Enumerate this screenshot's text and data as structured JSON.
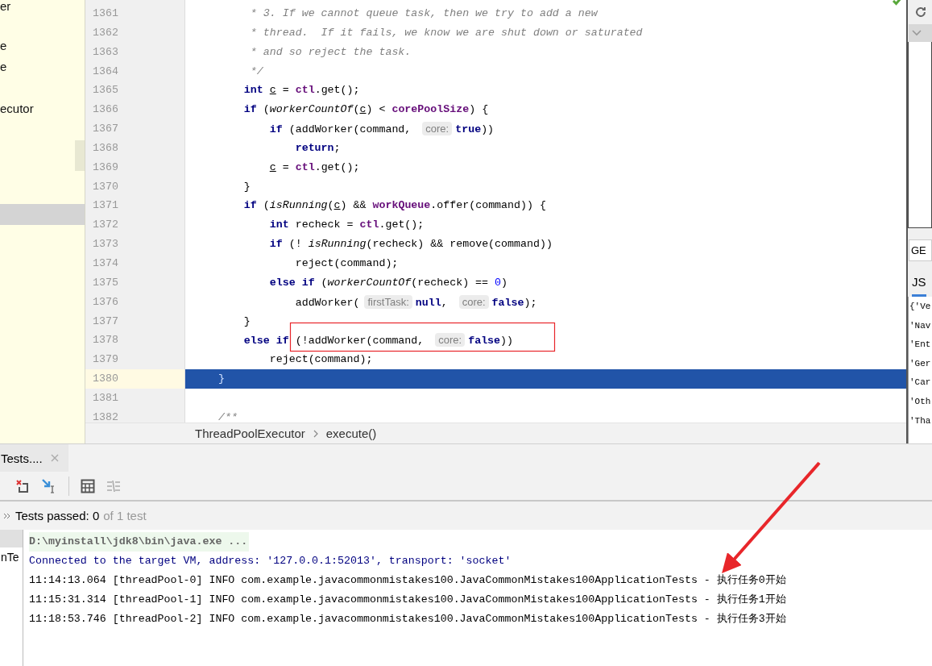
{
  "project_panel": {
    "items": [
      {
        "label": "er",
        "selected": false
      },
      {
        "label": "e",
        "selected": false
      },
      {
        "label": "e",
        "selected": false
      },
      {
        "label": "ecutor",
        "selected": false
      },
      {
        "selected": true
      }
    ]
  },
  "code": {
    "lines": [
      {
        "number": "1361",
        "selected": false,
        "tokens": [
          {
            "kind": "comment",
            "text": "         * 3. If we cannot queue task, then we try to add a new"
          }
        ]
      },
      {
        "number": "1362",
        "selected": false,
        "tokens": [
          {
            "kind": "comment",
            "text": "         * thread.  If it fails, we know we are shut down or saturated"
          }
        ]
      },
      {
        "number": "1363",
        "selected": false,
        "tokens": [
          {
            "kind": "comment",
            "text": "         * and so reject the task."
          }
        ]
      },
      {
        "number": "1364",
        "selected": false,
        "tokens": [
          {
            "kind": "comment",
            "text": "         */"
          }
        ]
      },
      {
        "number": "1365",
        "selected": false,
        "tokens": [
          {
            "kind": "kw",
            "text": "        int "
          },
          {
            "kind": "var",
            "text": "c"
          },
          {
            "kind": "plain",
            "text": " = "
          },
          {
            "kind": "field",
            "text": "ctl"
          },
          {
            "kind": "plain",
            "text": ".get();"
          }
        ]
      },
      {
        "number": "1366",
        "selected": false,
        "tokens": [
          {
            "kind": "kw",
            "text": "        if"
          },
          {
            "kind": "plain",
            "text": " ("
          },
          {
            "kind": "fn",
            "text": "workerCountOf"
          },
          {
            "kind": "plain",
            "text": "("
          },
          {
            "kind": "var",
            "text": "c"
          },
          {
            "kind": "plain",
            "text": ") < "
          },
          {
            "kind": "field",
            "text": "corePoolSize"
          },
          {
            "kind": "plain",
            "text": ") {"
          }
        ]
      },
      {
        "number": "1367",
        "selected": false,
        "tokens": [
          {
            "kind": "kw",
            "text": "            if"
          },
          {
            "kind": "plain",
            "text": " (addWorker(command, "
          },
          {
            "kind": "hint",
            "text": "core:"
          },
          {
            "kind": "kw",
            "text": "true"
          },
          {
            "kind": "plain",
            "text": "))"
          }
        ]
      },
      {
        "number": "1368",
        "selected": false,
        "tokens": [
          {
            "kind": "kw",
            "text": "                return"
          },
          {
            "kind": "plain",
            "text": ";"
          }
        ]
      },
      {
        "number": "1369",
        "selected": false,
        "tokens": [
          {
            "kind": "var",
            "text": "            c"
          },
          {
            "kind": "plain",
            "text": " = "
          },
          {
            "kind": "field",
            "text": "ctl"
          },
          {
            "kind": "plain",
            "text": ".get();"
          }
        ]
      },
      {
        "number": "1370",
        "selected": false,
        "tokens": [
          {
            "kind": "plain",
            "text": "        }"
          }
        ]
      },
      {
        "number": "1371",
        "selected": false,
        "tokens": [
          {
            "kind": "kw",
            "text": "        if"
          },
          {
            "kind": "plain",
            "text": " ("
          },
          {
            "kind": "fn",
            "text": "isRunning"
          },
          {
            "kind": "plain",
            "text": "("
          },
          {
            "kind": "var",
            "text": "c"
          },
          {
            "kind": "plain",
            "text": ") && "
          },
          {
            "kind": "field",
            "text": "workQueue"
          },
          {
            "kind": "plain",
            "text": ".offer(command)) {"
          }
        ]
      },
      {
        "number": "1372",
        "selected": false,
        "tokens": [
          {
            "kind": "kw",
            "text": "            int"
          },
          {
            "kind": "plain",
            "text": " recheck = "
          },
          {
            "kind": "field",
            "text": "ctl"
          },
          {
            "kind": "plain",
            "text": ".get();"
          }
        ]
      },
      {
        "number": "1373",
        "selected": false,
        "tokens": [
          {
            "kind": "kw",
            "text": "            if"
          },
          {
            "kind": "plain",
            "text": " (! "
          },
          {
            "kind": "fn",
            "text": "isRunning"
          },
          {
            "kind": "plain",
            "text": "(recheck) && remove(command))"
          }
        ]
      },
      {
        "number": "1374",
        "selected": false,
        "tokens": [
          {
            "kind": "plain",
            "text": "                reject(command);"
          }
        ]
      },
      {
        "number": "1375",
        "selected": false,
        "tokens": [
          {
            "kind": "kw",
            "text": "            else if"
          },
          {
            "kind": "plain",
            "text": " ("
          },
          {
            "kind": "fn",
            "text": "workerCountOf"
          },
          {
            "kind": "plain",
            "text": "(recheck) == "
          },
          {
            "kind": "num",
            "text": "0"
          },
          {
            "kind": "plain",
            "text": ")"
          }
        ]
      },
      {
        "number": "1376",
        "selected": false,
        "tokens": [
          {
            "kind": "plain",
            "text": "                addWorker("
          },
          {
            "kind": "hint",
            "text": "firstTask:"
          },
          {
            "kind": "kw",
            "text": "null"
          },
          {
            "kind": "plain",
            "text": ", "
          },
          {
            "kind": "hint",
            "text": "core:"
          },
          {
            "kind": "kw",
            "text": "false"
          },
          {
            "kind": "plain",
            "text": ");"
          }
        ]
      },
      {
        "number": "1377",
        "selected": false,
        "tokens": [
          {
            "kind": "plain",
            "text": "        }"
          }
        ]
      },
      {
        "number": "1378",
        "selected": false,
        "tokens": [
          {
            "kind": "kw",
            "text": "        else if"
          },
          {
            "kind": "plain",
            "text": " (!addWorker(command, "
          },
          {
            "kind": "hint",
            "text": "core:"
          },
          {
            "kind": "kw",
            "text": "false"
          },
          {
            "kind": "plain",
            "text": "))"
          }
        ]
      },
      {
        "number": "1379",
        "selected": false,
        "tokens": [
          {
            "kind": "plain",
            "text": "            reject(command);"
          }
        ]
      },
      {
        "number": "1380",
        "selected": true,
        "tokens": [
          {
            "kind": "plain",
            "text": "    }"
          }
        ]
      },
      {
        "number": "1381",
        "selected": false
      },
      {
        "number": "1382",
        "selected": false,
        "tokens": [
          {
            "kind": "comment",
            "text": "    /**"
          }
        ]
      }
    ]
  },
  "breadcrumb": [
    "ThreadPoolExecutor",
    "execute()"
  ],
  "right_panel": {
    "method": "GE",
    "tabs": [
      {
        "label": "JS",
        "selected": true
      }
    ],
    "response_lines": [
      "{'Ve",
      "'Nav",
      "'Ent",
      "'Ger",
      "'Car",
      "'Oth",
      "'Tha"
    ]
  },
  "run_panel": {
    "tab": "Tests....",
    "status": "Tests passed: 0",
    "detail": "of 1 test",
    "tree_item": "nTe",
    "console": [
      {
        "kind": "command",
        "text": "D:\\myinstall\\jdk8\\bin\\java.exe ..."
      },
      {
        "kind": "info",
        "text": "Connected to the target VM, address: '127.0.0.1:52013', transport: 'socket'"
      },
      {
        "kind": "log",
        "text": "11:14:13.064 [threadPool-0] INFO com.example.javacommonmistakes100.JavaCommonMistakes100ApplicationTests - 执行任务0开始"
      },
      {
        "kind": "log",
        "text": "11:15:31.314 [threadPool-1] INFO com.example.javacommonmistakes100.JavaCommonMistakes100ApplicationTests - 执行任务1开始"
      },
      {
        "kind": "log",
        "text": "11:18:53.746 [threadPool-2] INFO com.example.javacommonmistakes100.JavaCommonMistakes100ApplicationTests - 执行任务3开始"
      }
    ]
  }
}
